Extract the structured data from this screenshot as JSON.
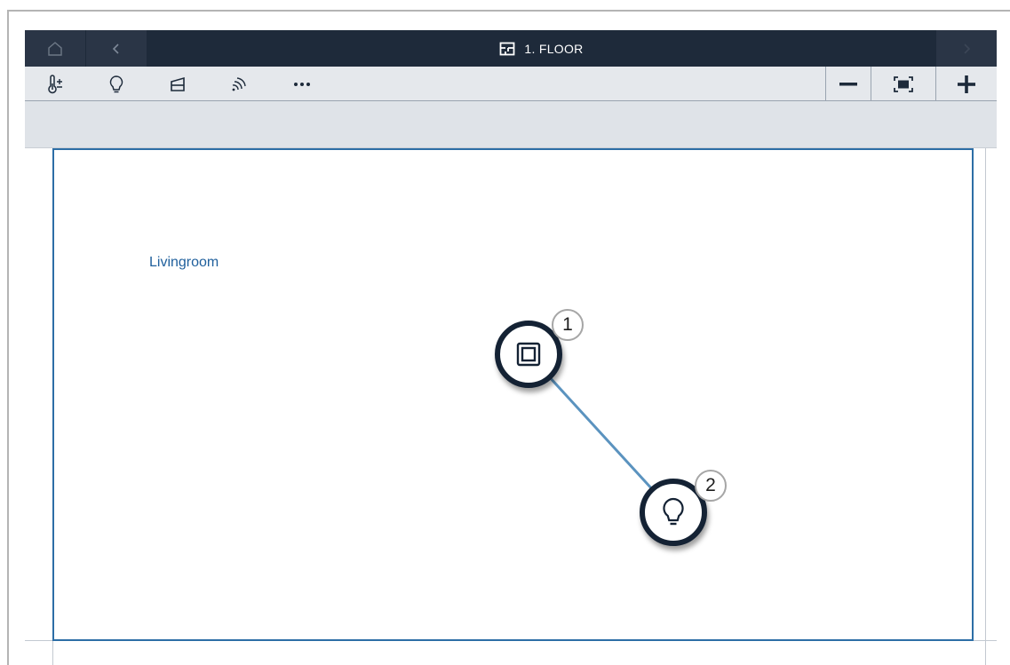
{
  "titlebar": {
    "title": "1. FLOOR",
    "home_icon": "home-icon",
    "back_icon": "chevron-left-icon",
    "forward_icon": "chevron-right-icon",
    "floor_icon": "floor-plan-icon"
  },
  "toolbar": {
    "tools": [
      {
        "name": "temperature-icon"
      },
      {
        "name": "light-bulb-icon"
      },
      {
        "name": "blind-icon"
      },
      {
        "name": "wireless-icon"
      },
      {
        "name": "more-icon"
      }
    ],
    "zoom": [
      {
        "name": "zoom-out-icon"
      },
      {
        "name": "fit-screen-icon"
      },
      {
        "name": "zoom-in-icon"
      }
    ]
  },
  "canvas": {
    "room_name": "Livingroom",
    "devices": [
      {
        "number": "1",
        "type": "switch-icon"
      },
      {
        "number": "2",
        "type": "light-bulb-icon"
      }
    ]
  },
  "colors": {
    "titlebar": "#1e2a3a",
    "accent": "#2d6ea6",
    "room_text": "#1f5f9c",
    "device_ring": "#142234",
    "link_line": "#5b93bf"
  }
}
